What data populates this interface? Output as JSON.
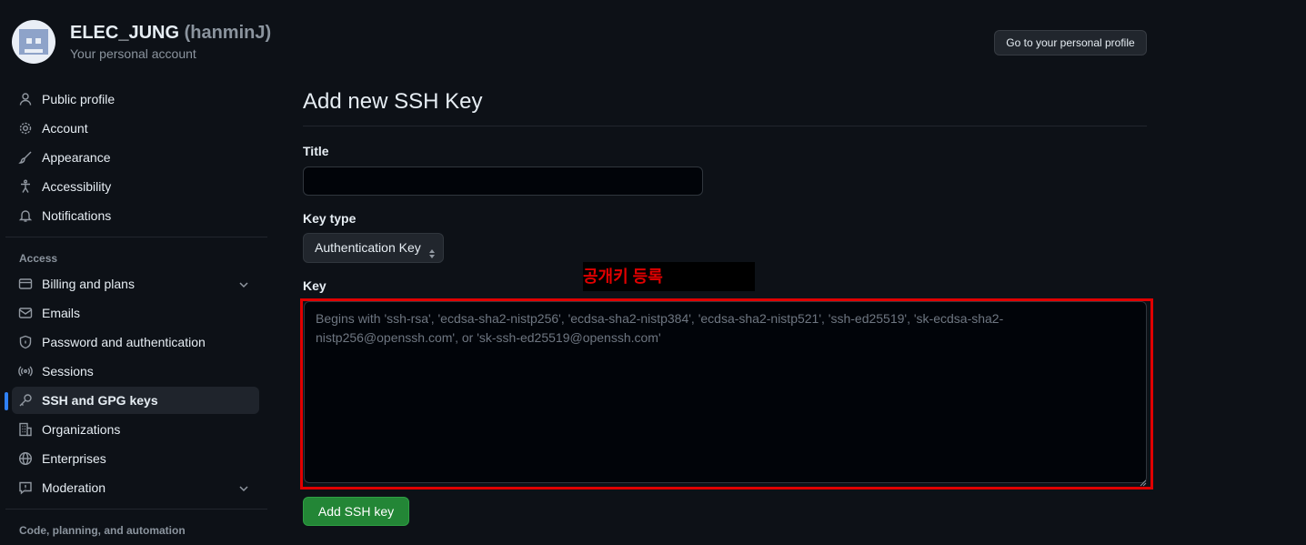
{
  "account": {
    "name": "ELEC_JUNG",
    "handle": "(hanminJ)",
    "subtitle": "Your personal account",
    "profile_button": "Go to your personal profile"
  },
  "sidebar": {
    "items": [
      {
        "label": "Public profile",
        "icon": "person-icon"
      },
      {
        "label": "Account",
        "icon": "gear-icon"
      },
      {
        "label": "Appearance",
        "icon": "paintbrush-icon"
      },
      {
        "label": "Accessibility",
        "icon": "accessibility-icon"
      },
      {
        "label": "Notifications",
        "icon": "bell-icon"
      }
    ],
    "access_heading": "Access",
    "access_items": [
      {
        "label": "Billing and plans",
        "icon": "credit-card-icon"
      },
      {
        "label": "Emails",
        "icon": "mail-icon"
      },
      {
        "label": "Password and authentication",
        "icon": "shield-lock-icon"
      },
      {
        "label": "Sessions",
        "icon": "broadcast-icon"
      },
      {
        "label": "SSH and GPG keys",
        "icon": "key-icon",
        "active": true
      },
      {
        "label": "Organizations",
        "icon": "organization-icon"
      },
      {
        "label": "Enterprises",
        "icon": "globe-icon"
      },
      {
        "label": "Moderation",
        "icon": "report-icon"
      }
    ],
    "code_heading": "Code, planning, and automation"
  },
  "form": {
    "page_title": "Add new SSH Key",
    "title_label": "Title",
    "title_value": "",
    "key_type_label": "Key type",
    "key_type_value": "Authentication Key",
    "key_label": "Key",
    "key_placeholder": "Begins with 'ssh-rsa', 'ecdsa-sha2-nistp256', 'ecdsa-sha2-nistp384', 'ecdsa-sha2-nistp521', 'ssh-ed25519', 'sk-ecdsa-sha2-nistp256@openssh.com', or 'sk-ssh-ed25519@openssh.com'",
    "submit_label": "Add SSH key"
  },
  "annotation": {
    "text": "공개키 등록",
    "color": "#e00000"
  },
  "colors": {
    "accent": "#2f81f7",
    "primary_button": "#238636",
    "highlight_border": "#e00000"
  }
}
